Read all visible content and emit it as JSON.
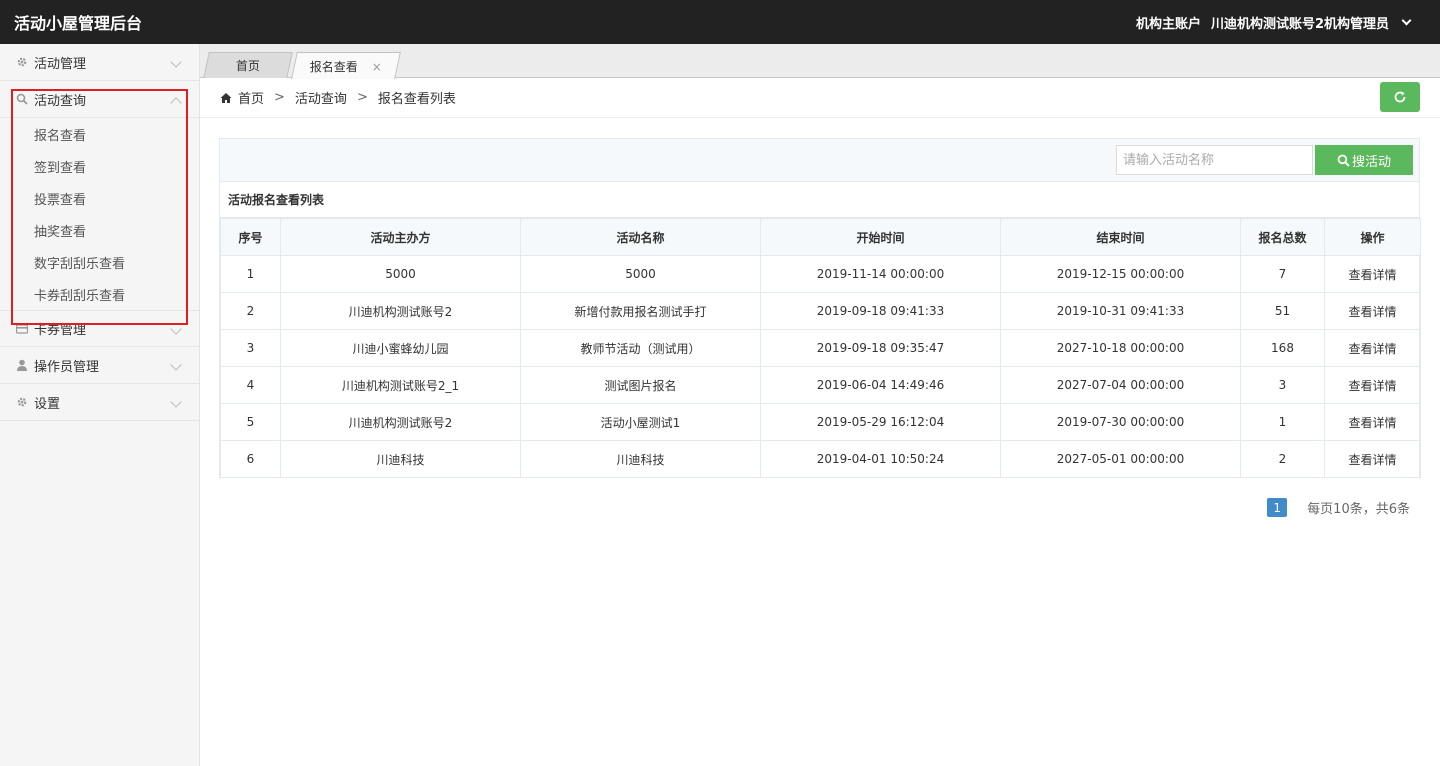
{
  "app": {
    "title": "活动小屋管理后台"
  },
  "account": {
    "role": "机构主账户",
    "user": "川迪机构测试账号2机构管理员"
  },
  "sidebar": {
    "groups": [
      {
        "label": "活动管理",
        "icon": "gear-icon",
        "expanded": false
      },
      {
        "label": "活动查询",
        "icon": "search-icon",
        "expanded": true,
        "items": [
          "报名查看",
          "签到查看",
          "投票查看",
          "抽奖查看",
          "数字刮刮乐查看",
          "卡券刮刮乐查看"
        ]
      },
      {
        "label": "卡券管理",
        "icon": "card-icon",
        "expanded": false
      },
      {
        "label": "操作员管理",
        "icon": "user-icon",
        "expanded": false
      },
      {
        "label": "设置",
        "icon": "gear-icon",
        "expanded": false
      }
    ]
  },
  "tabs": [
    {
      "label": "首页",
      "active": false
    },
    {
      "label": "报名查看",
      "active": true,
      "close": "×"
    }
  ],
  "breadcrumb": {
    "home": "首页",
    "level1": "活动查询",
    "level2": "报名查看列表",
    "separator": ">"
  },
  "search": {
    "placeholder": "请输入活动名称",
    "button": "搜活动"
  },
  "table": {
    "title": "活动报名查看列表",
    "headers": [
      "序号",
      "活动主办方",
      "活动名称",
      "开始时间",
      "结束时间",
      "报名总数",
      "操作"
    ],
    "rows": [
      [
        "1",
        "5000",
        "5000",
        "2019-11-14 00:00:00",
        "2019-12-15 00:00:00",
        "7",
        "查看详情"
      ],
      [
        "2",
        "川迪机构测试账号2",
        "新增付款用报名测试手打",
        "2019-09-18 09:41:33",
        "2019-10-31 09:41:33",
        "51",
        "查看详情"
      ],
      [
        "3",
        "川迪小蜜蜂幼儿园",
        "教师节活动（测试用）",
        "2019-09-18 09:35:47",
        "2027-10-18 00:00:00",
        "168",
        "查看详情"
      ],
      [
        "4",
        "川迪机构测试账号2_1",
        "测试图片报名",
        "2019-06-04 14:49:46",
        "2027-07-04 00:00:00",
        "3",
        "查看详情"
      ],
      [
        "5",
        "川迪机构测试账号2",
        "活动小屋测试1",
        "2019-05-29 16:12:04",
        "2019-07-30 00:00:00",
        "1",
        "查看详情"
      ],
      [
        "6",
        "川迪科技",
        "川迪科技",
        "2019-04-01 10:50:24",
        "2027-05-01 00:00:00",
        "2",
        "查看详情"
      ]
    ]
  },
  "pagination": {
    "current": "1",
    "summary": "每页10条，共6条"
  },
  "colors": {
    "topbar": "#222222",
    "accent_green": "#5cb85c",
    "page_blue": "#428bca",
    "highlight_red": "#e02020"
  }
}
